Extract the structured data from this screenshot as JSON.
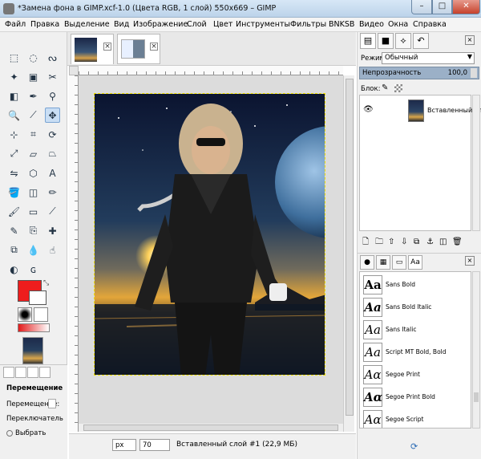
{
  "window": {
    "title": "*Замена фона в GIMP.xcf-1.0 (Цвета RGB, 1 слой) 550x669 – GIMP",
    "minimize": "–",
    "maximize": "□",
    "close": "✕"
  },
  "menu": [
    "Файл",
    "Правка",
    "Выделение",
    "Вид",
    "Изображение",
    "Слой",
    "Цвет",
    "Инструменты",
    "Фильтры",
    "BNKSB",
    "Видео",
    "Окна",
    "Справка"
  ],
  "tool_options": {
    "title": "Перемещение",
    "move_label": "Перемещение:",
    "switch_label": "Переключатель",
    "select_option": "Выбрать"
  },
  "status": {
    "unit": "px",
    "zoom": "70",
    "layer_info": "Вставленный слой #1 (22,9 МБ)"
  },
  "layers": {
    "mode_label": "Режим:",
    "mode_value": "Обычный",
    "opacity_label": "Непрозрачность",
    "opacity_value": "100,0",
    "lock_label": "Блок:",
    "layer_name": "Вставленный сло"
  },
  "fonts": [
    "Sans Bold",
    "Sans Bold Italic",
    "Sans Italic",
    "Script MT Bold, Bold",
    "Segoe Print",
    "Segoe Print Bold",
    "Segoe Script"
  ],
  "font_glyphs": [
    "Aa",
    "Aa",
    "Aa",
    "Aa",
    "Aα",
    "Aα",
    "Aα"
  ],
  "colors": {
    "foreground": "#ee1d1d",
    "background": "#ffffff",
    "accent": "#7aa4d3"
  }
}
